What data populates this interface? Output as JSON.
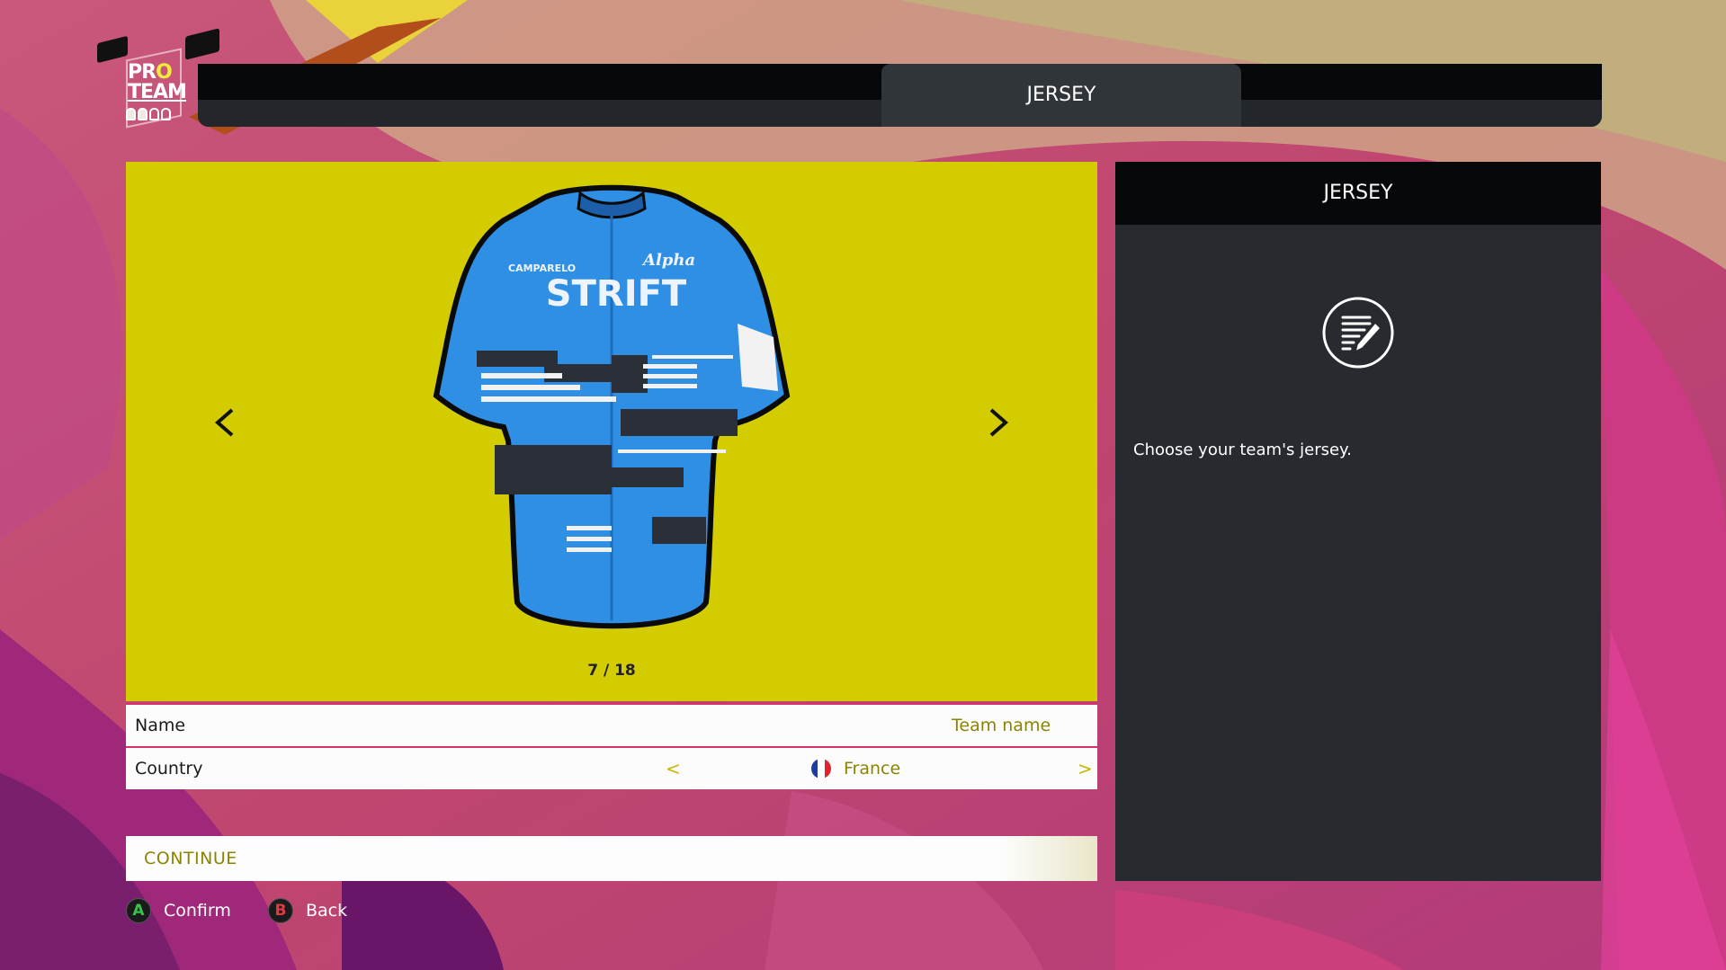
{
  "logo": {
    "line1_pre": "PR",
    "line1_o": "O",
    "line2": "TEAM"
  },
  "header": {
    "title": "JERSEY"
  },
  "preview": {
    "background_color": "#d2cc00",
    "prev_icon": "chevron-left-icon",
    "next_icon": "chevron-right-icon",
    "counter": "7 / 18",
    "jersey": {
      "brand": "STRIFT",
      "sponsor1": "CAMPARELO",
      "sponsor2": "Alpha",
      "color": "#2f8fe4"
    }
  },
  "fields": {
    "name": {
      "label": "Name",
      "value": "Team name"
    },
    "country": {
      "label": "Country",
      "value": "France",
      "prev": "<",
      "next": ">",
      "flag_colors": [
        "#1f3b9b",
        "#ffffff",
        "#e0242f"
      ]
    }
  },
  "continue_label": "CONTINUE",
  "hints": [
    {
      "button": "A",
      "label": "Confirm"
    },
    {
      "button": "B",
      "label": "Back"
    }
  ],
  "side": {
    "title": "JERSEY",
    "icon": "edit-document-icon",
    "description": "Choose your team's jersey."
  }
}
